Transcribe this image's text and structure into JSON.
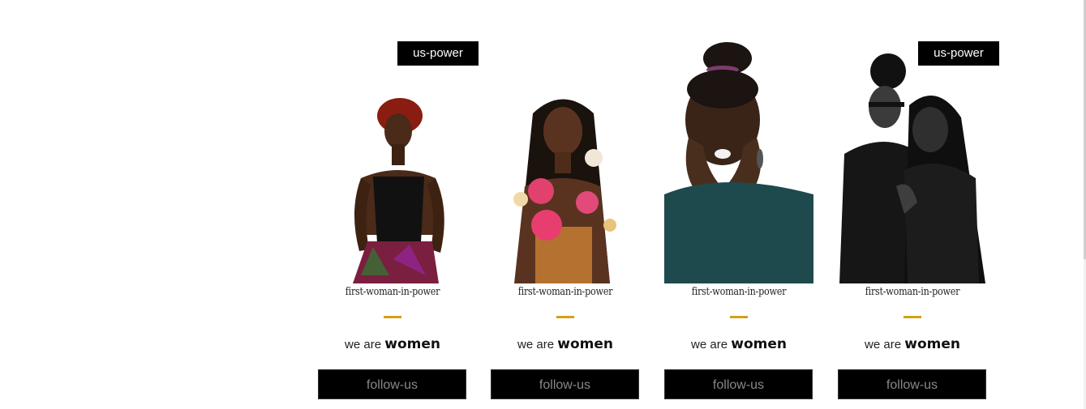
{
  "cards": [
    {
      "badge": "us-power",
      "photo": "woman-red-hair-patterned-skirt",
      "caption": "first-woman-in-power",
      "tagline_prefix": "we are",
      "tagline_strong": "women",
      "button_label": "follow-us"
    },
    {
      "badge": "",
      "photo": "woman-braids-pink-flowers",
      "caption": "first-woman-in-power",
      "tagline_prefix": "we are",
      "tagline_strong": "women",
      "button_label": "follow-us"
    },
    {
      "badge": "",
      "photo": "woman-smiling-hands-on-cheeks",
      "caption": "first-woman-in-power",
      "tagline_prefix": "we are",
      "tagline_strong": "women",
      "button_label": "follow-us"
    },
    {
      "badge": "us-power",
      "photo": "couple-black-and-white",
      "caption": "first-woman-in-power",
      "tagline_prefix": "we are",
      "tagline_strong": "women",
      "button_label": "follow-us"
    }
  ],
  "colors": {
    "accent_divider": "#d4a017",
    "button_bg": "#000000",
    "button_text": "#888888",
    "badge_bg": "#000000",
    "badge_text": "#ffffff"
  }
}
